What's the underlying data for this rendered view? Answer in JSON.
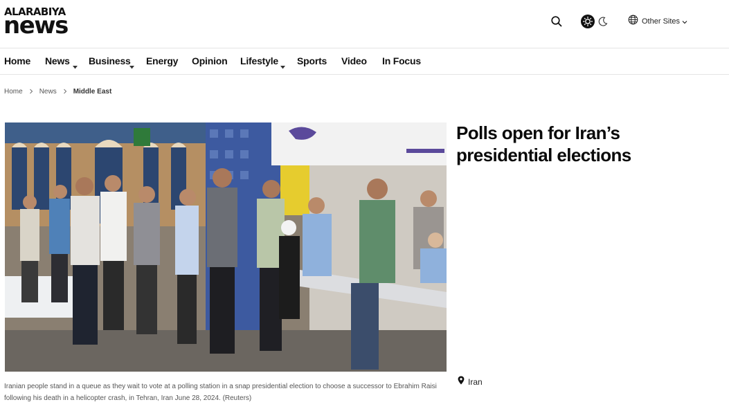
{
  "brand": {
    "logo_top": "ALARABIYA",
    "logo_bottom": "news"
  },
  "header": {
    "search_icon": "search-icon",
    "theme_icons": [
      "sun-icon",
      "moon-icon"
    ],
    "other_sites_label": "Other Sites"
  },
  "nav": {
    "items": [
      {
        "label": "Home",
        "has_dropdown": false
      },
      {
        "label": "News",
        "has_dropdown": true
      },
      {
        "label": "Business",
        "has_dropdown": true
      },
      {
        "label": "Energy",
        "has_dropdown": false
      },
      {
        "label": "Opinion",
        "has_dropdown": false
      },
      {
        "label": "Lifestyle",
        "has_dropdown": true
      },
      {
        "label": "Sports",
        "has_dropdown": false
      },
      {
        "label": "Video",
        "has_dropdown": false
      },
      {
        "label": "In Focus",
        "has_dropdown": false
      }
    ]
  },
  "breadcrumb": [
    "Home",
    "News",
    "Middle East"
  ],
  "article": {
    "headline": "Polls open for Iran’s presidential elections",
    "caption_line1": "Iranian people stand in a queue as they wait to vote at a polling station in a snap presidential election to choose a successor to Ebrahim Raisi",
    "caption_line2": "following his death in a helicopter crash, in Tehran, Iran June 28, 2024. (Reuters)",
    "tag": "Iran"
  },
  "colors": {
    "text": "#111111",
    "muted": "#555555",
    "divider": "#e4e4e4"
  }
}
